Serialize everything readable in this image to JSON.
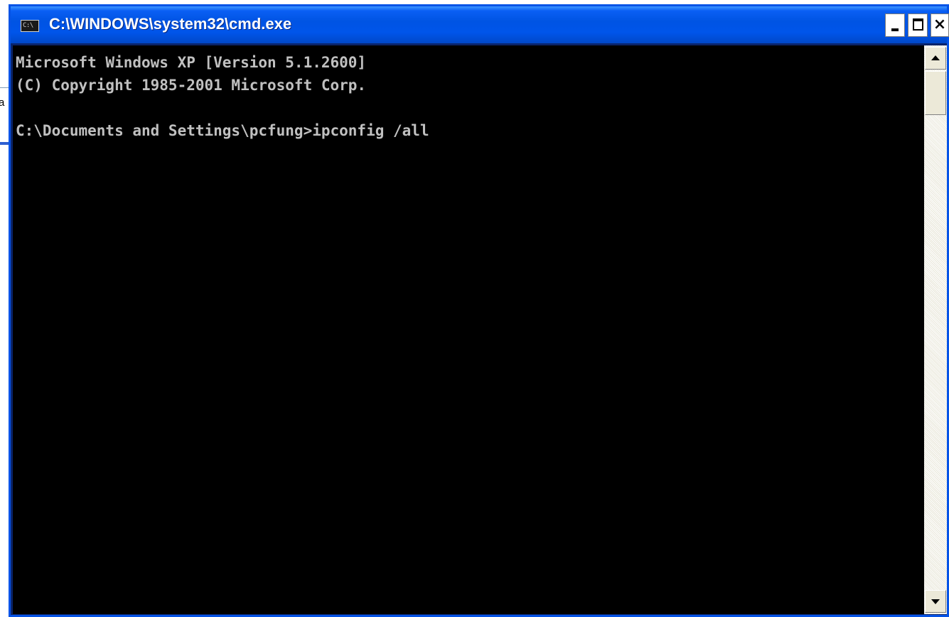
{
  "background_window": {
    "visible_text": "a"
  },
  "window": {
    "title": "C:\\WINDOWS\\system32\\cmd.exe",
    "icon_text": "C:\\",
    "titlebar_color": "#0054e3",
    "buttons": {
      "minimize_icon": "minimize-icon",
      "maximize_icon": "maximize-icon",
      "close_label": "×"
    }
  },
  "console": {
    "background": "#000000",
    "foreground": "#c0c0c0",
    "lines": [
      "Microsoft Windows XP [Version 5.1.2600]",
      "(C) Copyright 1985-2001 Microsoft Corp.",
      "",
      "C:\\Documents and Settings\\pcfung>ipconfig /all"
    ]
  },
  "scrollbar": {
    "up_icon": "arrow-up-icon",
    "down_icon": "arrow-down-icon"
  }
}
